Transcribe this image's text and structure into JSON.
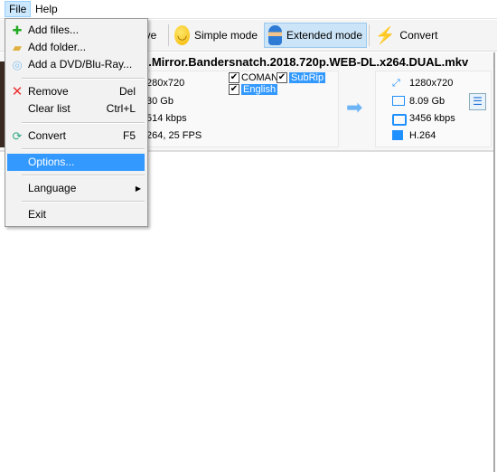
{
  "menubar": {
    "file": "File",
    "help": "Help"
  },
  "toolbar": {
    "remove": "ove",
    "simple": "Simple mode",
    "extended": "Extended mode",
    "convert": "Convert"
  },
  "item": {
    "title": "k.Mirror.Bandersnatch.2018.720p.WEB-DL.x264.DUAL.mkv",
    "source": {
      "resolution": "280x720",
      "size": "30 Gb",
      "bitrate": "514 kbps",
      "codec": "264, 25 FPS"
    },
    "tracks": [
      {
        "label": "COMAN",
        "checked": true
      },
      {
        "label": "SubRip",
        "checked": true
      },
      {
        "label": "English",
        "checked": true
      }
    ],
    "output": {
      "resolution": "1280x720",
      "size": "8.09 Gb",
      "bitrate": "3456 kbps",
      "codec": "H.264"
    }
  },
  "file_menu": [
    {
      "label": "Add files...",
      "icon": "add-files-icon"
    },
    {
      "label": "Add folder...",
      "icon": "folder-icon"
    },
    {
      "label": "Add a DVD/Blu-Ray...",
      "icon": "disc-icon"
    },
    {
      "label": "Remove",
      "shortcut": "Del",
      "icon": "remove-icon"
    },
    {
      "label": "Clear list",
      "shortcut": "Ctrl+L"
    },
    {
      "label": "Convert",
      "shortcut": "F5",
      "icon": "convert-icon"
    },
    {
      "label": "Options..."
    },
    {
      "label": "Language",
      "submenu": true
    },
    {
      "label": "Exit"
    }
  ],
  "colors": {
    "highlight": "#3399ff",
    "selected_button": "#cce4f7",
    "accent": "#1e90ff"
  }
}
